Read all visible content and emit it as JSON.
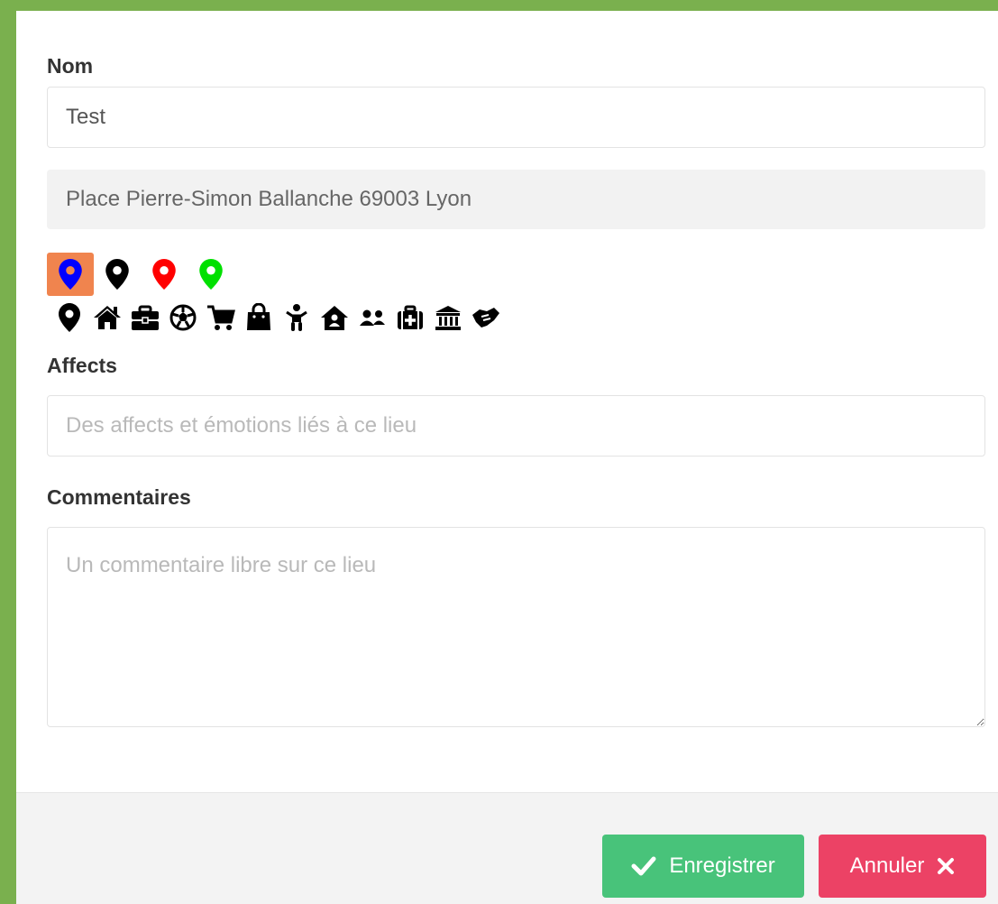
{
  "form": {
    "name_label": "Nom",
    "name_value": "Test",
    "address_value": "Place Pierre-Simon Ballanche 69003 Lyon",
    "affects_label": "Affects",
    "affects_placeholder": "Des affects et émotions liés à ce lieu",
    "comments_label": "Commentaires",
    "comments_placeholder": "Un commentaire libre sur ce lieu"
  },
  "marker_colors": [
    {
      "name": "blue",
      "hex": "#0000ff",
      "selected": true
    },
    {
      "name": "black",
      "hex": "#000000",
      "selected": false
    },
    {
      "name": "red",
      "hex": "#ff0000",
      "selected": false
    },
    {
      "name": "green",
      "hex": "#00e000",
      "selected": false
    }
  ],
  "marker_icons": [
    "map-marker-icon",
    "home-icon",
    "briefcase-icon",
    "soccer-ball-icon",
    "shopping-cart-icon",
    "shopping-bag-icon",
    "child-icon",
    "house-user-icon",
    "users-icon",
    "medkit-icon",
    "university-icon",
    "handshake-icon"
  ],
  "footer": {
    "save_label": "Enregistrer",
    "cancel_label": "Annuler"
  },
  "colors": {
    "frame": "#7ab04e",
    "selected_highlight": "#f0844e",
    "save_button": "#48c37a",
    "cancel_button": "#ec4265"
  }
}
